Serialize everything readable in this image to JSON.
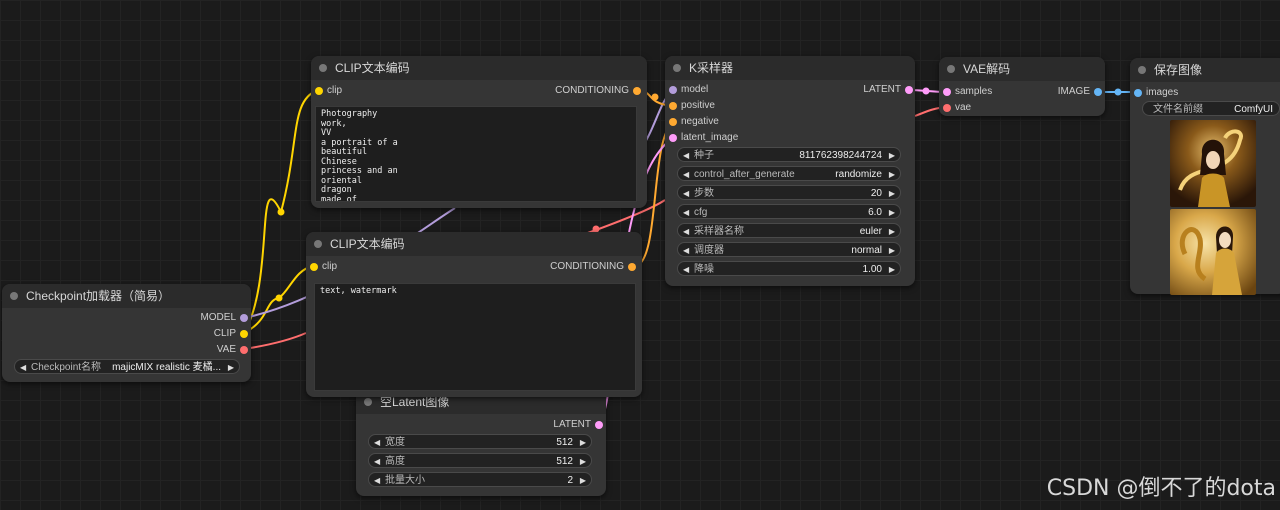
{
  "colors": {
    "model": "#b39ddb",
    "clip": "#ffd500",
    "vae": "#ff6e6e",
    "conditioning": "#ffa931",
    "latent": "#ff9cf9",
    "image": "#64b5f6"
  },
  "nodes": {
    "clip_encode_top": {
      "title": "CLIP文本编码",
      "input_clip": "clip",
      "output_conditioning": "CONDITIONING",
      "text": "Photography\nwork,\nVV\na portrait of a\nbeautiful\nChinese\nprincess and an\noriental\ndragon\nmade of"
    },
    "clip_encode_bottom": {
      "title": "CLIP文本编码",
      "input_clip": "clip",
      "output_conditioning": "CONDITIONING",
      "text": "text, watermark"
    },
    "checkpoint_loader": {
      "title": "Checkpoint加载器（简易）",
      "out_model": "MODEL",
      "out_clip": "CLIP",
      "out_vae": "VAE",
      "ckpt_label": "Checkpoint名称",
      "ckpt_value": "majicMIX realistic 麦橘..."
    },
    "ksampler": {
      "title": "K采样器",
      "in_model": "model",
      "in_positive": "positive",
      "in_negative": "negative",
      "in_latent": "latent_image",
      "out_latent": "LATENT",
      "widgets": [
        {
          "label": "种子",
          "value": "811762398244724"
        },
        {
          "label": "control_after_generate",
          "value": "randomize"
        },
        {
          "label": "步数",
          "value": "20"
        },
        {
          "label": "cfg",
          "value": "6.0"
        },
        {
          "label": "采样器名称",
          "value": "euler"
        },
        {
          "label": "调度器",
          "value": "normal"
        },
        {
          "label": "降噪",
          "value": "1.00"
        }
      ]
    },
    "vae_decode": {
      "title": "VAE解码",
      "in_samples": "samples",
      "in_vae": "vae",
      "out_image": "IMAGE"
    },
    "save_image": {
      "title": "保存图像",
      "in_images": "images",
      "prefix_label": "文件名前缀",
      "prefix_value": "ComfyUI"
    },
    "empty_latent": {
      "title": "空Latent图像",
      "out_latent": "LATENT",
      "widgets": [
        {
          "label": "宽度",
          "value": "512"
        },
        {
          "label": "高度",
          "value": "512"
        },
        {
          "label": "批量大小",
          "value": "2"
        }
      ]
    }
  },
  "watermark": "CSDN @倒不了的dota"
}
